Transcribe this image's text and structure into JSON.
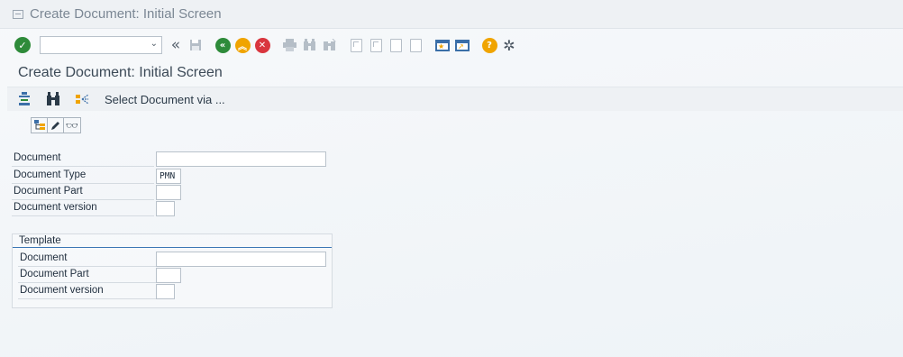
{
  "window": {
    "title": "Create Document: Initial Screen"
  },
  "system_toolbar": {
    "command_field": {
      "value": "",
      "placeholder": ""
    },
    "icons": [
      "enter-icon",
      "command-dropdown-icon",
      "collapse-icon",
      "save-icon",
      "back-icon",
      "exit-icon",
      "cancel-icon",
      "print-icon",
      "find-icon",
      "find-next-icon",
      "first-page-icon",
      "previous-page-icon",
      "next-page-icon",
      "last-page-icon",
      "new-session-icon",
      "shortcut-icon",
      "help-icon",
      "settings-icon"
    ]
  },
  "page": {
    "title": "Create Document: Initial Screen"
  },
  "app_toolbar": {
    "select_document_label": "Select Document via ..."
  },
  "fields": {
    "document": {
      "label": "Document",
      "value": ""
    },
    "document_type": {
      "label": "Document Type",
      "value": "PMN"
    },
    "document_part": {
      "label": "Document Part",
      "value": ""
    },
    "document_version": {
      "label": "Document version",
      "value": ""
    }
  },
  "template": {
    "title": "Template",
    "document": {
      "label": "Document",
      "value": ""
    },
    "document_part": {
      "label": "Document Part",
      "value": ""
    },
    "document_version": {
      "label": "Document version",
      "value": ""
    }
  },
  "colors": {
    "accent": "#3b77b5",
    "ok_green": "#2e8b3a",
    "cancel_red": "#d9363e",
    "warn_orange": "#f0a400"
  }
}
